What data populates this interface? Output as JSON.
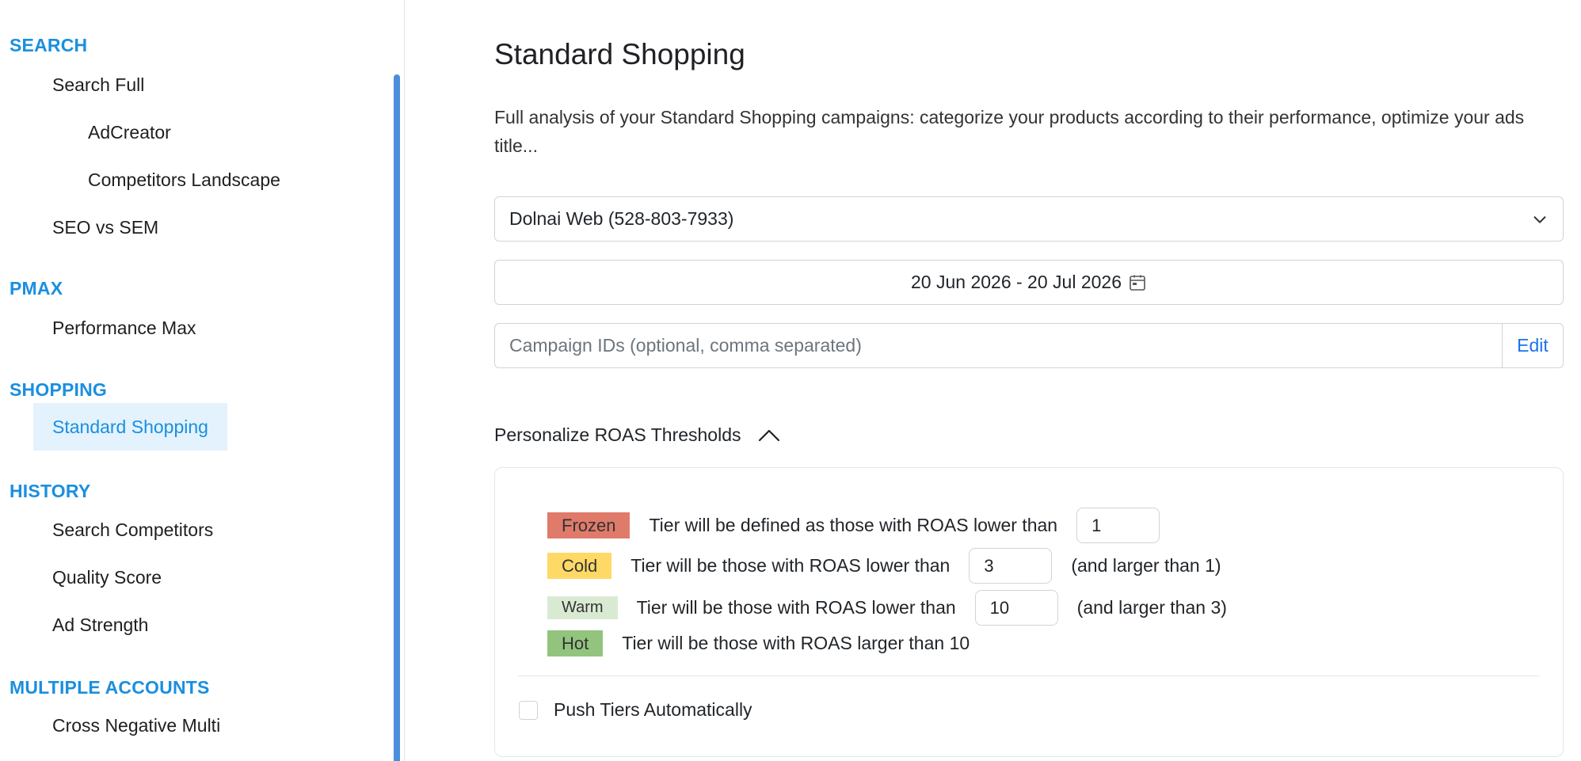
{
  "sidebar": {
    "sections": {
      "search": "SEARCH",
      "pmax": "PMAX",
      "shopping": "SHOPPING",
      "history": "HISTORY",
      "multiple_accounts": "MULTIPLE ACCOUNTS"
    },
    "items": {
      "search_full": "Search Full",
      "adcreator": "AdCreator",
      "competitors_landscape": "Competitors Landscape",
      "seo_vs_sem": "SEO vs SEM",
      "performance_max": "Performance Max",
      "standard_shopping": "Standard Shopping",
      "search_competitors": "Search Competitors",
      "quality_score": "Quality Score",
      "ad_strength": "Ad Strength",
      "cross_negative_multi": "Cross Negative Multi"
    },
    "active_item": "Standard Shopping"
  },
  "main": {
    "title": "Standard Shopping",
    "description": "Full analysis of your Standard Shopping campaigns: categorize your products according to their performance, optimize your ads title...",
    "account_select": "Dolnai Web (528-803-7933)",
    "date_range": "20 Jun 2026 - 20 Jul 2026",
    "campaign_ids_placeholder": "Campaign IDs (optional, comma separated)",
    "campaign_ids_value": "",
    "edit_label": "Edit",
    "roas_toggle_label": "Personalize ROAS Thresholds",
    "tiers": {
      "frozen": {
        "badge": "Frozen",
        "text": "Tier will be defined as those with ROAS lower than",
        "value": "1",
        "suffix": ""
      },
      "cold": {
        "badge": "Cold",
        "text": "Tier will be those with ROAS lower than",
        "value": "3",
        "suffix": "(and larger than 1)"
      },
      "warm": {
        "badge": "Warm",
        "text": "Tier will be those with ROAS lower than",
        "value": "10",
        "suffix": "(and larger than 3)"
      },
      "hot": {
        "badge": "Hot",
        "text": "Tier will be those with ROAS larger than 10"
      }
    },
    "push_tiers_label": "Push Tiers Automatically",
    "push_tiers_checked": false
  },
  "colors": {
    "accent": "#1a8fe0",
    "active_bg": "#e3f2fd",
    "scrollbar": "#4a8fdc",
    "frozen": "#e07a6a",
    "cold": "#ffd966",
    "warm": "#d9ead3",
    "hot": "#93c47d",
    "link": "#1a73e8"
  },
  "icons": {
    "select": "chevron-down-icon",
    "date": "calendar-icon",
    "toggle": "chevron-up-icon"
  }
}
